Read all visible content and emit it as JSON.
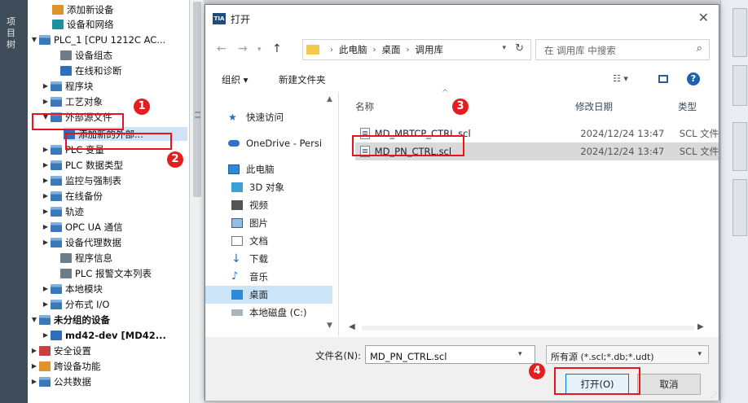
{
  "left_sidebar": {
    "vertical_text": "项目树"
  },
  "tree": {
    "items": [
      {
        "label": "添加新设备"
      },
      {
        "label": "设备和网络"
      },
      {
        "label": "PLC_1 [CPU 1212C AC..."
      },
      {
        "label": "设备组态"
      },
      {
        "label": "在线和诊断"
      },
      {
        "label": "程序块"
      },
      {
        "label": "工艺对象"
      },
      {
        "label": "外部源文件"
      },
      {
        "label": "添加新的外部..."
      },
      {
        "label": "PLC 变量"
      },
      {
        "label": "PLC 数据类型"
      },
      {
        "label": "监控与强制表"
      },
      {
        "label": "在线备份"
      },
      {
        "label": "轨迹"
      },
      {
        "label": "OPC UA 通信"
      },
      {
        "label": "设备代理数据"
      },
      {
        "label": "程序信息"
      },
      {
        "label": "PLC 报警文本列表"
      },
      {
        "label": "本地模块"
      },
      {
        "label": "分布式 I/O"
      },
      {
        "label": "未分组的设备"
      },
      {
        "label": "md42-dev [MD42..."
      },
      {
        "label": "安全设置"
      },
      {
        "label": "跨设备功能"
      },
      {
        "label": "公共数据"
      }
    ]
  },
  "dialog": {
    "title": "打开",
    "close_glyph": "✕",
    "app_icon_text": "TIA",
    "breadcrumb": [
      "此电脑",
      "桌面",
      "调用库"
    ],
    "search_placeholder": "在 调用库 中搜索",
    "toolbar": {
      "organize": "组织 ▾",
      "new_folder": "新建文件夹"
    },
    "nav_items": [
      {
        "label": "快速访问"
      },
      {
        "label": "OneDrive - Persi"
      },
      {
        "label": "此电脑"
      },
      {
        "label": "3D 对象"
      },
      {
        "label": "视频"
      },
      {
        "label": "图片"
      },
      {
        "label": "文档"
      },
      {
        "label": "下载"
      },
      {
        "label": "音乐"
      },
      {
        "label": "桌面"
      },
      {
        "label": "本地磁盘 (C:)"
      }
    ],
    "columns": {
      "name": "名称",
      "modified": "修改日期",
      "type": "类型"
    },
    "files": [
      {
        "name": "MD_MBTCP_CTRL.scl",
        "modified": "2024/12/24 13:47",
        "type": "SCL 文件"
      },
      {
        "name": "MD_PN_CTRL.scl",
        "modified": "2024/12/24 13:47",
        "type": "SCL 文件"
      }
    ],
    "filename_label": "文件名(N):",
    "filename_value": "MD_PN_CTRL.scl",
    "filter_value": "所有源 (*.scl;*.db;*.udt)",
    "open_button": "打开(O)",
    "cancel_button": "取消"
  },
  "annotations": [
    "1",
    "2",
    "3",
    "4"
  ],
  "colors": {
    "annotation_red": "#e41e1e",
    "selection_blue": "#cce4f7",
    "accent": "#0078d7"
  }
}
